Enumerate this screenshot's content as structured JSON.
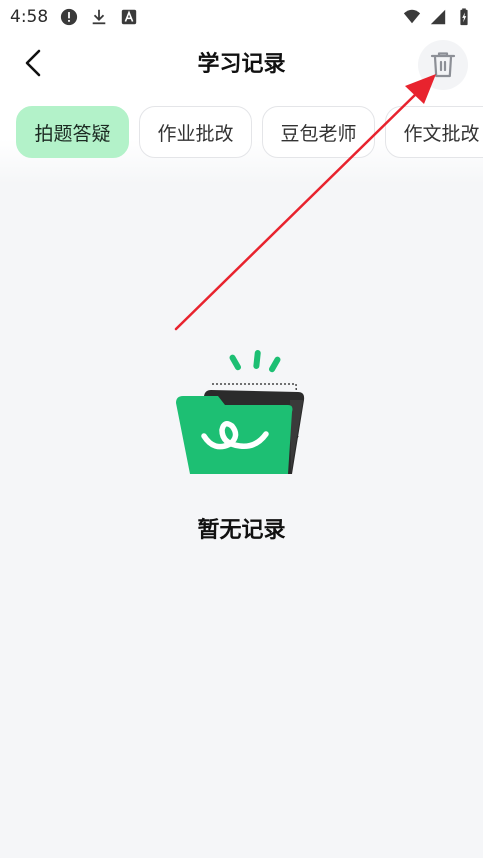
{
  "status_bar": {
    "time": "4:58",
    "icons": [
      "alert-icon",
      "download-icon",
      "font-icon",
      "wifi-icon",
      "signal-icon",
      "battery-icon"
    ]
  },
  "header": {
    "title": "学习记录",
    "back_icon": "chevron-left-icon",
    "delete_icon": "trash-icon"
  },
  "tabs": [
    {
      "label": "拍题答疑",
      "active": true
    },
    {
      "label": "作业批改",
      "active": false
    },
    {
      "label": "豆包老师",
      "active": false
    },
    {
      "label": "作文批改",
      "active": false
    }
  ],
  "empty_state": {
    "text": "暂无记录",
    "icon": "empty-folder-icon"
  },
  "colors": {
    "accent_green": "#1dbf73",
    "active_tab_bg": "#b3f2c9",
    "annotation_arrow": "#e8232e"
  }
}
